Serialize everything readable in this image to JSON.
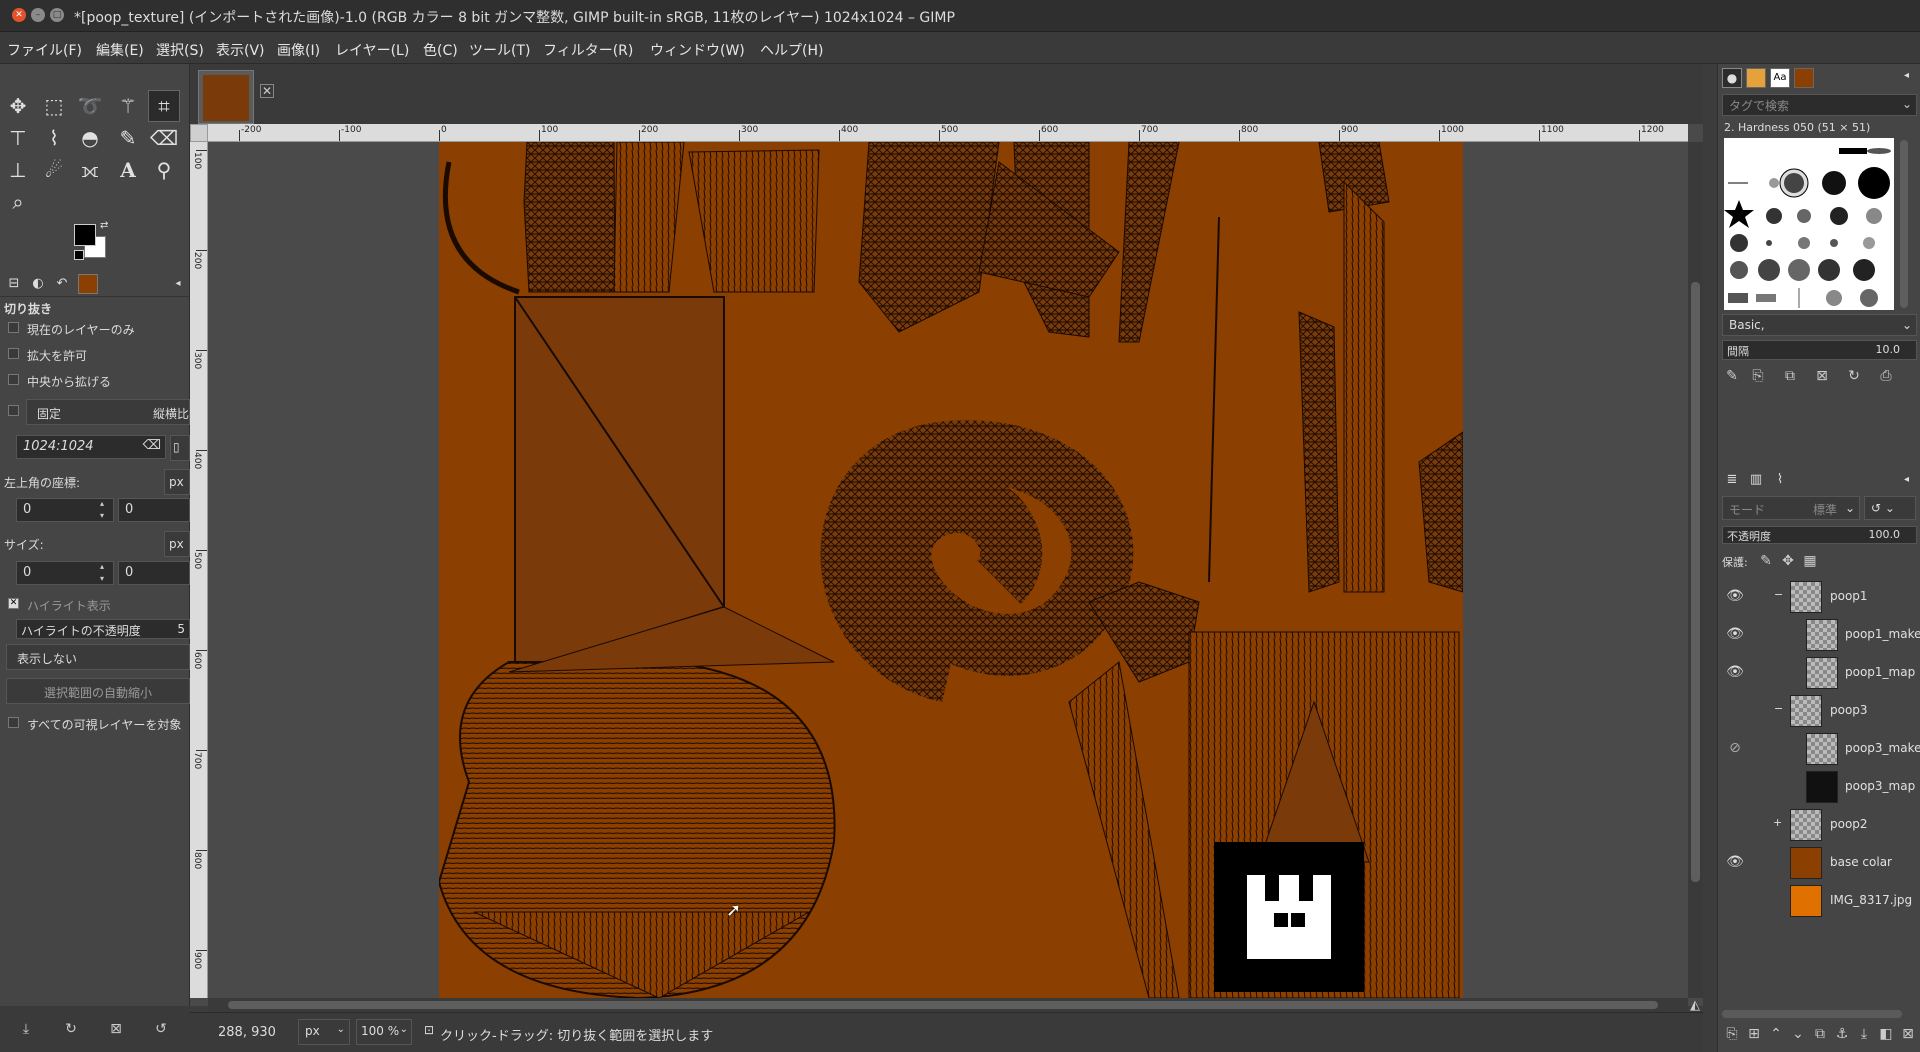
{
  "window": {
    "title": "*[poop_texture] (インポートされた画像)-1.0 (RGB カラー 8 bit ガンマ整数, GIMP built-in sRGB, 11枚のレイヤー) 1024x1024 – GIMP"
  },
  "menu": [
    "ファイル(F)",
    "編集(E)",
    "選択(S)",
    "表示(V)",
    "画像(I)",
    "レイヤー(L)",
    "色(C)",
    "ツール(T)",
    "フィルター(R)",
    "ウィンドウ(W)",
    "ヘルプ(H)"
  ],
  "tool_options": {
    "title": "切り抜き",
    "current_layer_only": "現在のレイヤーのみ",
    "allow_grow": "拡大を許可",
    "expand_center": "中央から拡げる",
    "fixed": "固定",
    "fixed_mode": "縦横比",
    "ratio_value": "1024:1024",
    "position_label": "左上角の座標:",
    "position_unit": "px",
    "pos_x": "0",
    "pos_y": "0",
    "size_label": "サイズ:",
    "size_unit": "px",
    "size_w": "0",
    "size_h": "0",
    "highlight": "ハイライト表示",
    "highlight_opacity": "ハイライトの不透明度",
    "highlight_opacity_value": "5",
    "guides": "表示しない",
    "auto_shrink": "選択範囲の自動縮小",
    "all_visible": "すべての可視レイヤーを対象"
  },
  "ruler": {
    "h_ticks": [
      "-200",
      "-100",
      "0",
      "100",
      "200",
      "300",
      "400",
      "500",
      "600",
      "700",
      "800",
      "900",
      "1000",
      "1100",
      "1200"
    ],
    "v_ticks": [
      "1",
      "2",
      "3",
      "4",
      "5",
      "6",
      "7",
      "8",
      "9"
    ]
  },
  "status": {
    "coords": "288, 930",
    "unit": "px",
    "zoom": "100 %",
    "message": "クリック-ドラッグ: 切り抜く範囲を選択します"
  },
  "brushes": {
    "filter_placeholder": "タグで検索",
    "current_brush": "2. Hardness 050 (51 × 51)",
    "preset": "Basic,",
    "spacing_label": "間隔",
    "spacing_value": "10.0"
  },
  "layers_panel": {
    "mode_label": "モード",
    "mode_value": "標準",
    "opacity_label": "不透明度",
    "opacity_value": "100.0",
    "lock_label": "保護:"
  },
  "layers": [
    {
      "name": "poop1",
      "visible": true,
      "group": true,
      "expanded": true,
      "indent": 0
    },
    {
      "name": "poop1_make",
      "visible": true,
      "group": false,
      "indent": 1
    },
    {
      "name": "poop1_map",
      "visible": true,
      "group": false,
      "indent": 1
    },
    {
      "name": "poop3",
      "visible": false,
      "group": true,
      "expanded": true,
      "indent": 0
    },
    {
      "name": "poop3_make",
      "visible": "toggled",
      "group": false,
      "indent": 1
    },
    {
      "name": "poop3_map",
      "visible": false,
      "group": false,
      "indent": 1
    },
    {
      "name": "poop2",
      "visible": false,
      "group": true,
      "expanded": false,
      "indent": 0
    },
    {
      "name": "base colar",
      "visible": true,
      "group": false,
      "indent": 0
    },
    {
      "name": "IMG_8317.jpg",
      "visible": false,
      "group": false,
      "indent": 0
    }
  ],
  "colors": {
    "image_bg": "#8b3f00",
    "texture_brown": "#7a3a0a",
    "fg": "#000000",
    "bg": "#ffffff"
  }
}
